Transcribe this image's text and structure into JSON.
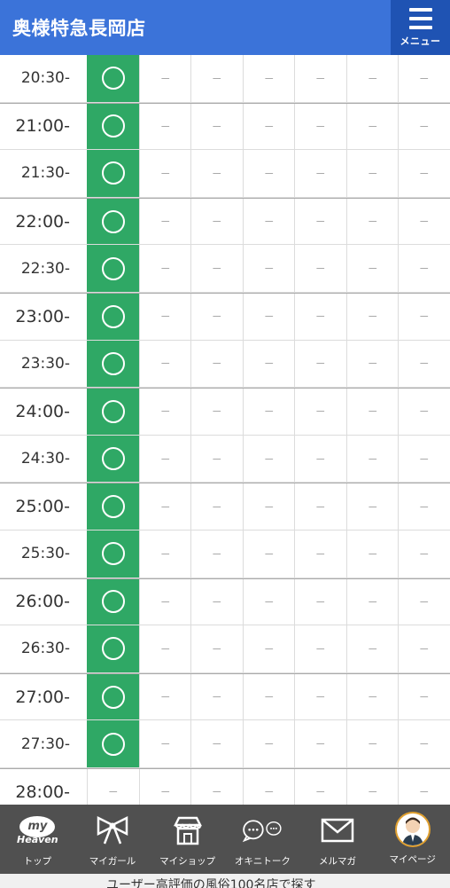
{
  "header": {
    "shop_name": "奥様特急長岡店",
    "menu_label": "メニュー"
  },
  "schedule": {
    "rows": [
      {
        "time": "20:30-",
        "available": true
      },
      {
        "time": "21:00-",
        "available": true
      },
      {
        "time": "21:30-",
        "available": true
      },
      {
        "time": "22:00-",
        "available": true
      },
      {
        "time": "22:30-",
        "available": true
      },
      {
        "time": "23:00-",
        "available": true
      },
      {
        "time": "23:30-",
        "available": true
      },
      {
        "time": "24:00-",
        "available": true
      },
      {
        "time": "24:30-",
        "available": true
      },
      {
        "time": "25:00-",
        "available": true
      },
      {
        "time": "25:30-",
        "available": true
      },
      {
        "time": "26:00-",
        "available": true
      },
      {
        "time": "26:30-",
        "available": true
      },
      {
        "time": "27:00-",
        "available": true
      },
      {
        "time": "27:30-",
        "available": true
      },
      {
        "time": "28:00-",
        "available": false
      }
    ],
    "unavailable_mark": "－",
    "available_color": "#2fa865"
  },
  "bottom_nav": {
    "items": [
      {
        "label": "トップ",
        "icon": "my-heaven-logo-icon"
      },
      {
        "label": "マイガール",
        "icon": "ribbon-icon"
      },
      {
        "label": "マイショップ",
        "icon": "shop-icon"
      },
      {
        "label": "オキニトーク",
        "icon": "chat-bubbles-icon"
      },
      {
        "label": "メルマガ",
        "icon": "mail-icon"
      },
      {
        "label": "マイページ",
        "icon": "avatar-icon"
      }
    ],
    "logo_my": "my",
    "logo_heaven": "Heaven"
  },
  "footer": {
    "text": "ユーザー高評価の風俗100名店で探す"
  },
  "colors": {
    "header_bg": "#3b73d9",
    "menu_bg": "#1f53b3",
    "nav_bg": "#505050"
  }
}
